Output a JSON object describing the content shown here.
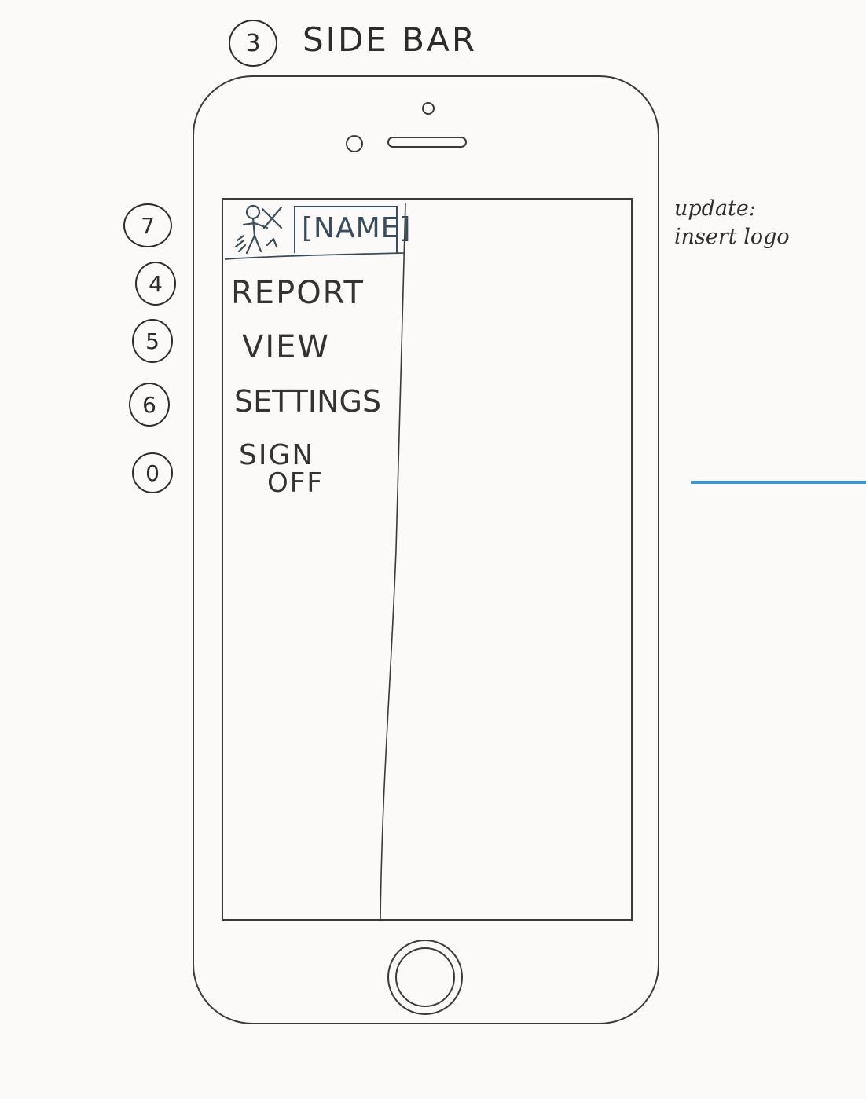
{
  "heading": {
    "number": "3",
    "title": "SIDE BAR"
  },
  "sidebar": {
    "name_label": "[NAME]",
    "items": [
      {
        "label": "REPORT",
        "callout": "4"
      },
      {
        "label": "VIEW",
        "callout": "5"
      },
      {
        "label": "SETTINGS",
        "callout": "6"
      },
      {
        "label_line1": "SIGN",
        "label_line2": "OFF",
        "callout": "0"
      }
    ],
    "header_callout": "7"
  },
  "note": {
    "line1": "update:",
    "line2": "insert logo"
  },
  "colors": {
    "ink": "#2c2c2c",
    "name_ink": "#3a4d5c",
    "accent_rule": "#3b97d8",
    "paper": "#fbfaf8"
  }
}
